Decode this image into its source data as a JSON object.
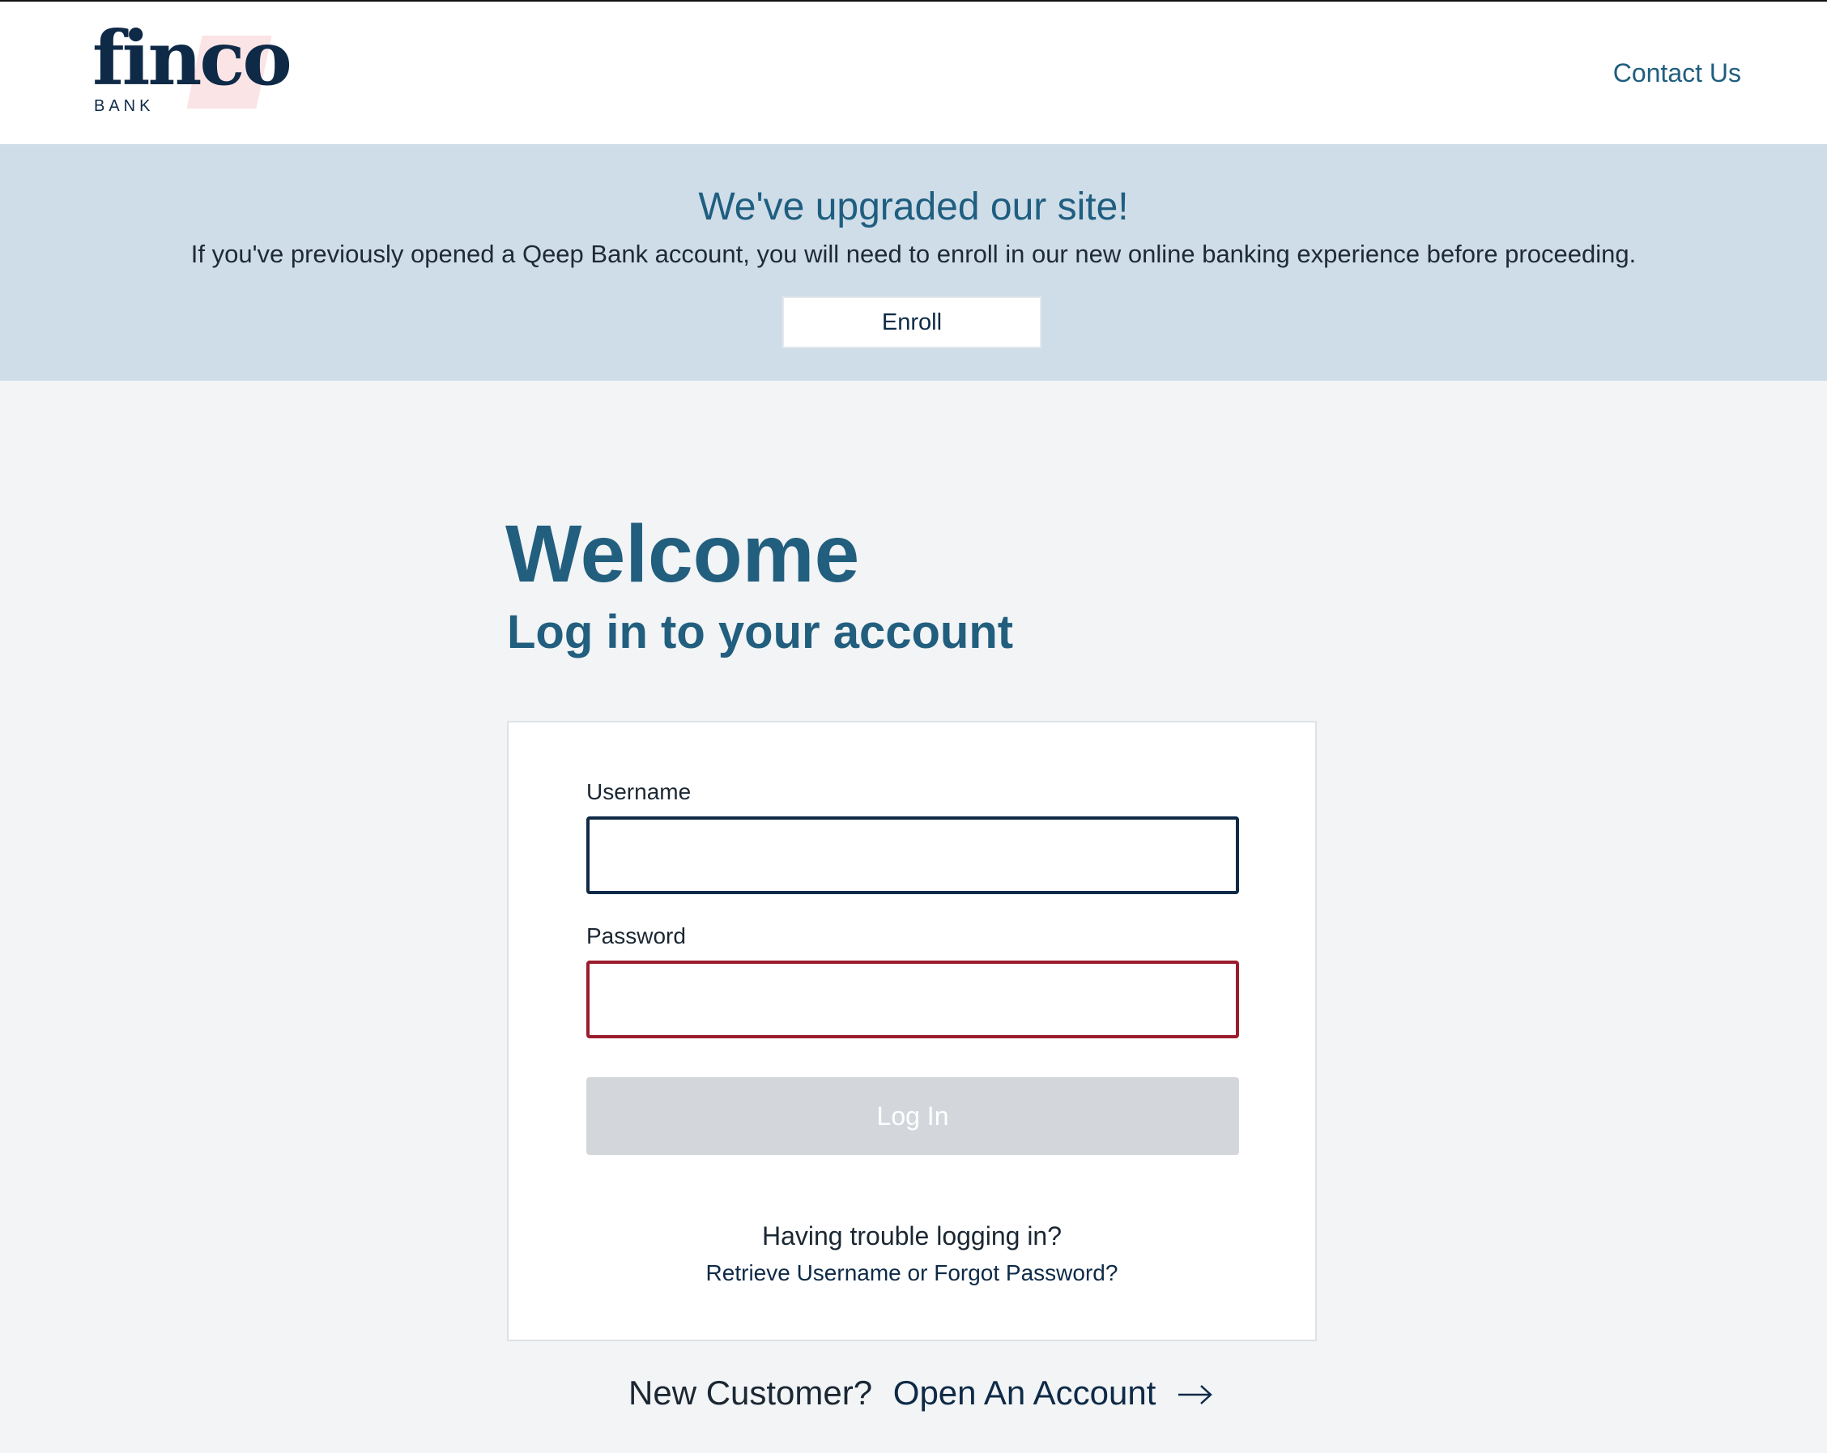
{
  "header": {
    "logo_word": "finco",
    "logo_sub": "BANK",
    "contact_label": "Contact Us"
  },
  "banner": {
    "title": "We've upgraded our site!",
    "text": "If you've previously opened a Qeep Bank account, you will need to enroll in our new online banking experience before proceeding.",
    "enroll_label": "Enroll"
  },
  "main": {
    "welcome": "Welcome",
    "subtitle": "Log in to your account"
  },
  "login_form": {
    "username_label": "Username",
    "username_value": "",
    "password_label": "Password",
    "password_value": "",
    "login_label": "Log In",
    "trouble_text": "Having trouble logging in?",
    "retrieve_label": "Retrieve Username",
    "or_text": "or",
    "forgot_label": "Forgot Password?"
  },
  "footer": {
    "new_customer_text": "New Customer?",
    "open_account_label": "Open An Account",
    "arrow_icon": "arrow-right-icon"
  },
  "colors": {
    "brand_navy": "#0e2a47",
    "brand_blue": "#225e7e",
    "banner_bg": "#cfdde8",
    "error_red": "#9b1c2c",
    "disabled_gray": "#d3d7dc"
  }
}
